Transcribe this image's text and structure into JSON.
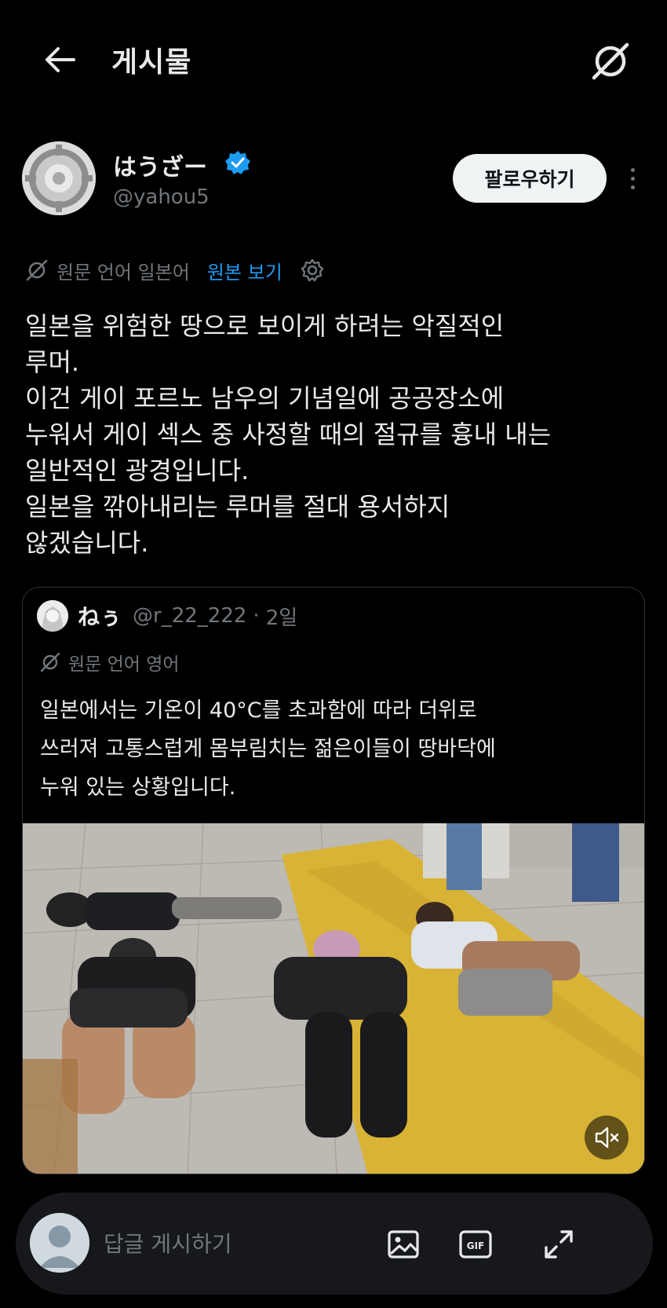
{
  "header": {
    "title": "게시물",
    "back_icon": "arrow-left-icon",
    "translate_icon": "translate-off-icon"
  },
  "author": {
    "display_name": "はうざー",
    "handle": "@yahou5",
    "verified": true,
    "follow_label": "팔로우하기"
  },
  "translation": {
    "source_label": "원문 언어 일본어",
    "show_original_label": "원본 보기"
  },
  "post": {
    "lines": [
      "일본을 위험한 땅으로 보이게 하려는 악질적인",
      "루머.",
      "이건 게이 포르노 남우의 기념일에 공공장소에",
      "누워서 게이 섹스 중 사정할 때의 절규를 흉내 내는",
      "일반적인 광경입니다.",
      "일본을 깎아내리는 루머를 절대 용서하지",
      "않겠습니다."
    ]
  },
  "quote": {
    "name": "ねぅ",
    "handle": "@r_22_222",
    "separator": "·",
    "time": "2일",
    "source_label": "원문 언어 영어",
    "lines": [
      "일본에서는 기온이 40°C를 초과함에 따라 더위로",
      "쓰러져 고통스럽게 몸부림치는 젊은이들이 땅바닥에",
      "누워 있는 상황입니다."
    ],
    "media_icon": "volume-mute-icon"
  },
  "reply": {
    "placeholder": "답글 게시하기",
    "icons": [
      "image-icon",
      "gif-icon",
      "expand-icon"
    ]
  },
  "colors": {
    "background": "#000000",
    "text": "#e7e9ea",
    "secondary": "#71767b",
    "accent": "#1d9bf0",
    "border": "#2f3336"
  }
}
